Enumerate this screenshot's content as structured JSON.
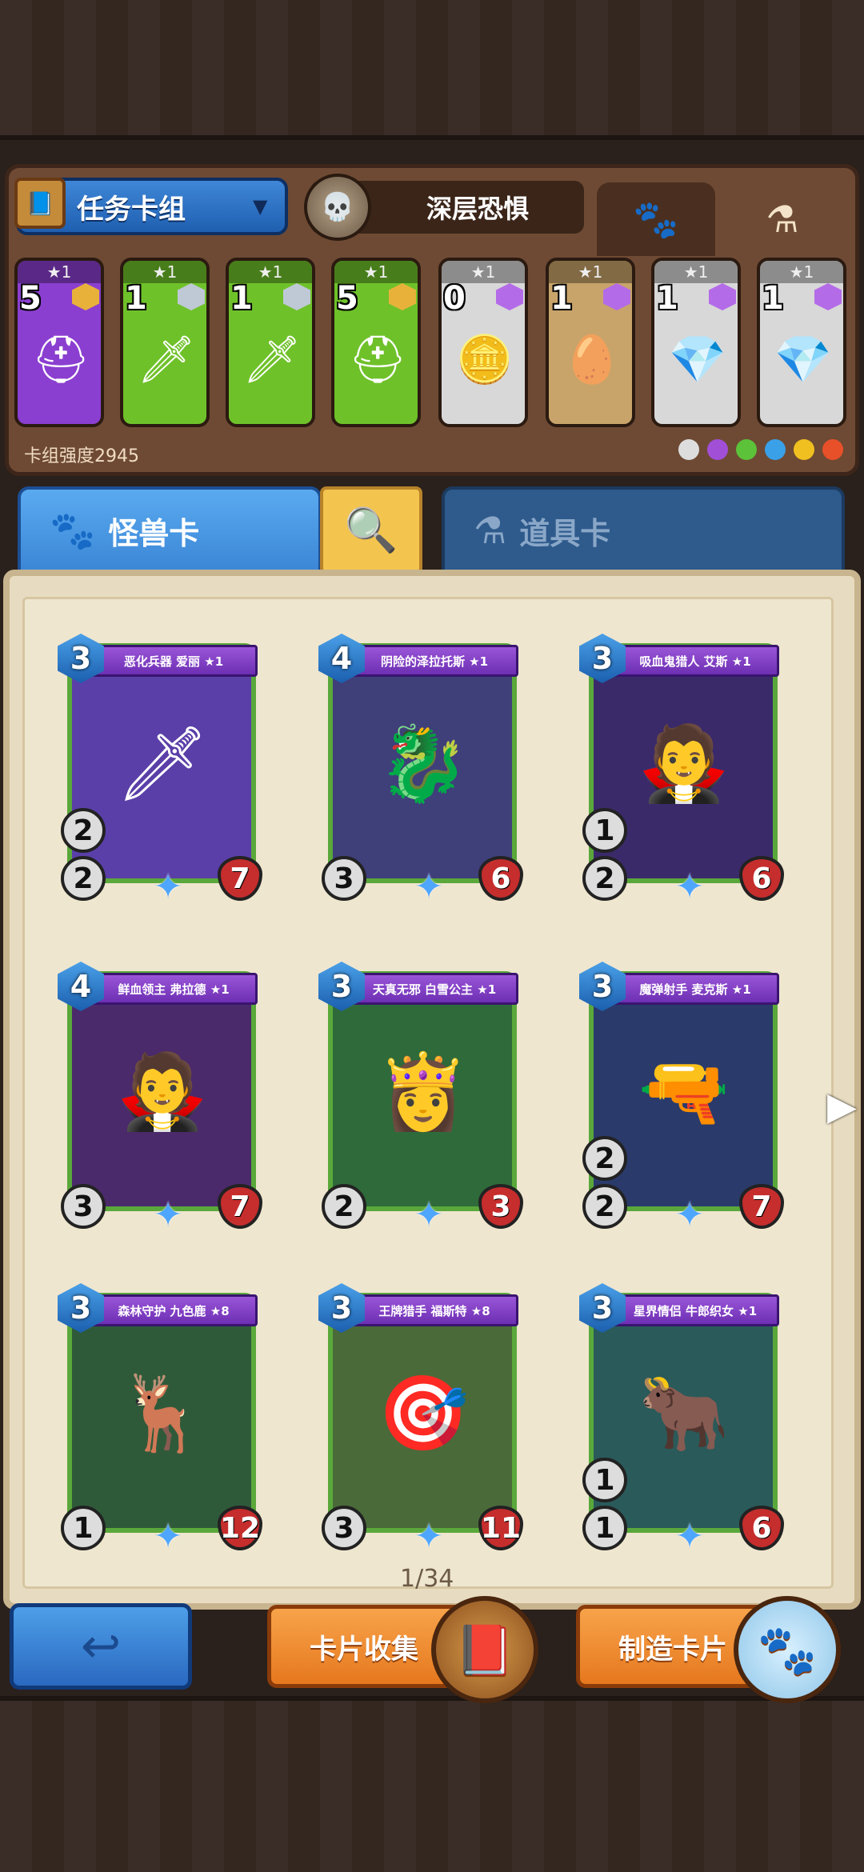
{
  "deck": {
    "title": "任务卡组",
    "opponent": "深层恐惧",
    "strength_label": "卡组强度2945",
    "tab_icons": [
      "paw-icon",
      "potion-icon"
    ],
    "slots": [
      {
        "stars": "★1",
        "count": "5",
        "frame": "#8b3fd0",
        "gem": "#e8b23a",
        "art": "⛑"
      },
      {
        "stars": "★1",
        "count": "1",
        "frame": "#6fc12a",
        "gem": "#bfc9d6",
        "art": "🗡"
      },
      {
        "stars": "★1",
        "count": "1",
        "frame": "#6fc12a",
        "gem": "#bfc9d6",
        "art": "🗡"
      },
      {
        "stars": "★1",
        "count": "5",
        "frame": "#6fc12a",
        "gem": "#e8b23a",
        "art": "⛑"
      },
      {
        "stars": "★1",
        "count": "0",
        "frame": "#d8d8d8",
        "gem": "#b46be8",
        "art": "🪙"
      },
      {
        "stars": "★1",
        "count": "1",
        "frame": "#c8a46a",
        "gem": "#b46be8",
        "art": "🥚"
      },
      {
        "stars": "★1",
        "count": "1",
        "frame": "#d8d8d8",
        "gem": "#b46be8",
        "art": "💎"
      },
      {
        "stars": "★1",
        "count": "1",
        "frame": "#d8d8d8",
        "gem": "#b46be8",
        "art": "💎"
      }
    ],
    "element_colors": [
      "#dddddd",
      "#a24fd8",
      "#5cc23a",
      "#3aa0e8",
      "#f0c020",
      "#e8502a"
    ]
  },
  "tabs": {
    "monster": "怪兽卡",
    "item": "道具卡"
  },
  "cards": [
    {
      "cost": "3",
      "name": "恶化兵器 爱丽 ★1",
      "spd": "2",
      "atk": "2",
      "hp": "7",
      "art": "🗡",
      "bg": "#5a3fa8"
    },
    {
      "cost": "4",
      "name": "阴险的泽拉托斯 ★1",
      "spd": "",
      "atk": "3",
      "hp": "6",
      "art": "🐉",
      "bg": "#3f3f7a"
    },
    {
      "cost": "3",
      "name": "吸血鬼猎人 艾斯 ★1",
      "spd": "1",
      "atk": "2",
      "hp": "6",
      "art": "🧛",
      "bg": "#3a2a6a"
    },
    {
      "cost": "4",
      "name": "鲜血领主 弗拉德 ★1",
      "spd": "",
      "atk": "3",
      "hp": "7",
      "art": "🧛",
      "bg": "#4a2a6a"
    },
    {
      "cost": "3",
      "name": "天真无邪 白雪公主 ★1",
      "spd": "",
      "atk": "2",
      "hp": "3",
      "art": "👸",
      "bg": "#2f6a3a"
    },
    {
      "cost": "3",
      "name": "魔弹射手 麦克斯 ★1",
      "spd": "2",
      "atk": "2",
      "hp": "7",
      "art": "🔫",
      "bg": "#2a3a6a"
    },
    {
      "cost": "3",
      "name": "森林守护 九色鹿 ★8",
      "spd": "",
      "atk": "1",
      "hp": "12",
      "art": "🦌",
      "bg": "#2f5a3a"
    },
    {
      "cost": "3",
      "name": "王牌猎手 福斯特 ★8",
      "spd": "",
      "atk": "3",
      "hp": "11",
      "art": "🎯",
      "bg": "#4a6a3a"
    },
    {
      "cost": "3",
      "name": "星界情侣 牛郎织女 ★1",
      "spd": "1",
      "atk": "1",
      "hp": "6",
      "art": "🐂",
      "bg": "#2a5a5a"
    }
  ],
  "page": "1/34",
  "buttons": {
    "back": "back-arrow-icon",
    "collection": "卡片收集",
    "craft": "制造卡片"
  }
}
